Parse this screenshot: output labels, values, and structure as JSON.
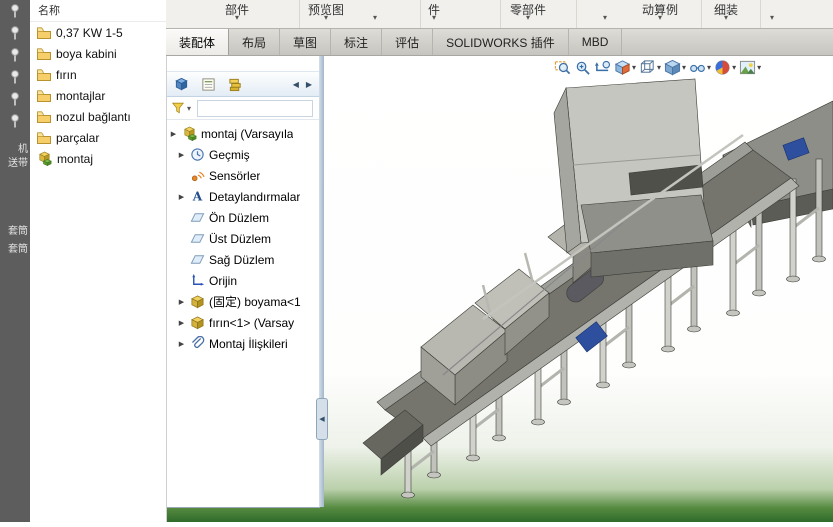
{
  "left_strip": {
    "pins": [
      "pin-icon",
      "pin-icon",
      "pin-icon",
      "pin-icon",
      "pin-icon",
      "pin-icon"
    ],
    "labels": [
      "机",
      "送带",
      "套筒",
      "套筒"
    ]
  },
  "file_panel": {
    "header": "名称",
    "items": [
      {
        "label": "0,37 KW 1-5",
        "icon": "folder-icon"
      },
      {
        "label": "boya kabini",
        "icon": "folder-icon"
      },
      {
        "label": "fırın",
        "icon": "folder-icon"
      },
      {
        "label": "montajlar",
        "icon": "folder-icon"
      },
      {
        "label": "nozul bağlantı",
        "icon": "folder-icon"
      },
      {
        "label": "parçalar",
        "icon": "folder-icon"
      },
      {
        "label": "montaj",
        "icon": "assembly-icon"
      }
    ]
  },
  "ribbon": {
    "groups": [
      {
        "label": "部件"
      },
      {
        "label": "预览图"
      },
      {
        "label": "件"
      },
      {
        "label": "零部件"
      },
      {
        "label": "动算例"
      },
      {
        "label": "细装"
      }
    ],
    "tabs": [
      {
        "label": "装配体",
        "active": true
      },
      {
        "label": "布局",
        "active": false
      },
      {
        "label": "草图",
        "active": false
      },
      {
        "label": "标注",
        "active": false
      },
      {
        "label": "评估",
        "active": false
      },
      {
        "label": "SOLIDWORKS 插件",
        "active": false
      },
      {
        "label": "MBD",
        "active": false
      }
    ]
  },
  "tree_panel": {
    "tabs": [
      "feature-manager-icon",
      "property-manager-icon",
      "configuration-manager-icon"
    ],
    "filter_icon": "filter-funnel-icon",
    "items": [
      {
        "label": "montaj (Varsayıla",
        "icon": "assembly-icon",
        "arrow": true,
        "indent": 0
      },
      {
        "label": "Geçmiş",
        "icon": "history-icon",
        "arrow": true,
        "indent": 1
      },
      {
        "label": "Sensörler",
        "icon": "sensors-icon",
        "arrow": false,
        "indent": 1
      },
      {
        "label": "Detaylandırmalar",
        "icon": "annotations-icon",
        "arrow": true,
        "indent": 1
      },
      {
        "label": "Ön Düzlem",
        "icon": "plane-icon",
        "arrow": false,
        "indent": 1
      },
      {
        "label": "Üst Düzlem",
        "icon": "plane-icon",
        "arrow": false,
        "indent": 1
      },
      {
        "label": "Sağ Düzlem",
        "icon": "plane-icon",
        "arrow": false,
        "indent": 1
      },
      {
        "label": "Orijin",
        "icon": "origin-icon",
        "arrow": false,
        "indent": 1
      },
      {
        "label": "(固定) boyama<1",
        "icon": "part-icon",
        "arrow": true,
        "indent": 1
      },
      {
        "label": "fırın<1> (Varsay",
        "icon": "part-icon",
        "arrow": true,
        "indent": 1
      },
      {
        "label": "Montaj İlişkileri",
        "icon": "mates-icon",
        "arrow": true,
        "indent": 1
      }
    ]
  },
  "viewport": {
    "toolbar": [
      {
        "icon": "zoom-fit-icon",
        "caret": false
      },
      {
        "icon": "zoom-area-icon",
        "caret": false
      },
      {
        "icon": "previous-view-icon",
        "caret": false
      },
      {
        "icon": "section-view-icon",
        "caret": true
      },
      {
        "icon": "view-orientation-icon",
        "caret": true
      },
      {
        "icon": "display-style-icon",
        "caret": true
      },
      {
        "icon": "hide-show-icon",
        "caret": true
      },
      {
        "icon": "appearance-icon",
        "caret": true
      },
      {
        "icon": "scene-icon",
        "caret": true
      }
    ],
    "model": "conveyor-oven-assembly"
  },
  "colors": {
    "accent_green_bottom": "#2f6b2a",
    "folder_yellow": "#f7cf6a",
    "dock_strip_gray": "#5d5d5d",
    "motor_blue": "#2d4f9e",
    "splitter_blue": "#a2b7c9"
  }
}
